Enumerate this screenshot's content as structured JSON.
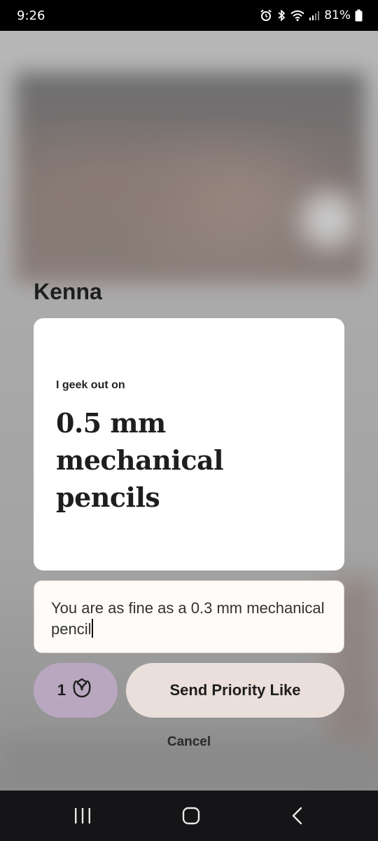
{
  "status_bar": {
    "time": "9:26",
    "battery": "81%",
    "icons": [
      "alarm-icon",
      "bluetooth-icon",
      "wifi-icon",
      "signal-icon",
      "battery-icon"
    ]
  },
  "profile": {
    "name": "Kenna"
  },
  "prompt": {
    "question": "I geek out on",
    "answer": "0.5 mm mechanical pencils"
  },
  "comment": {
    "value": "You are as fine as a 0.3 mm mechanical pencil"
  },
  "roses": {
    "count": "1",
    "icon": "rose-icon"
  },
  "actions": {
    "send_label": "Send Priority Like",
    "cancel_label": "Cancel"
  },
  "nav": {
    "icons": [
      "recent-apps-icon",
      "home-icon",
      "back-icon"
    ]
  },
  "colors": {
    "roses_button": "#b9a7c0",
    "send_button": "#eadfdb",
    "card": "#ffffff",
    "comment_box": "#fefbf8"
  }
}
